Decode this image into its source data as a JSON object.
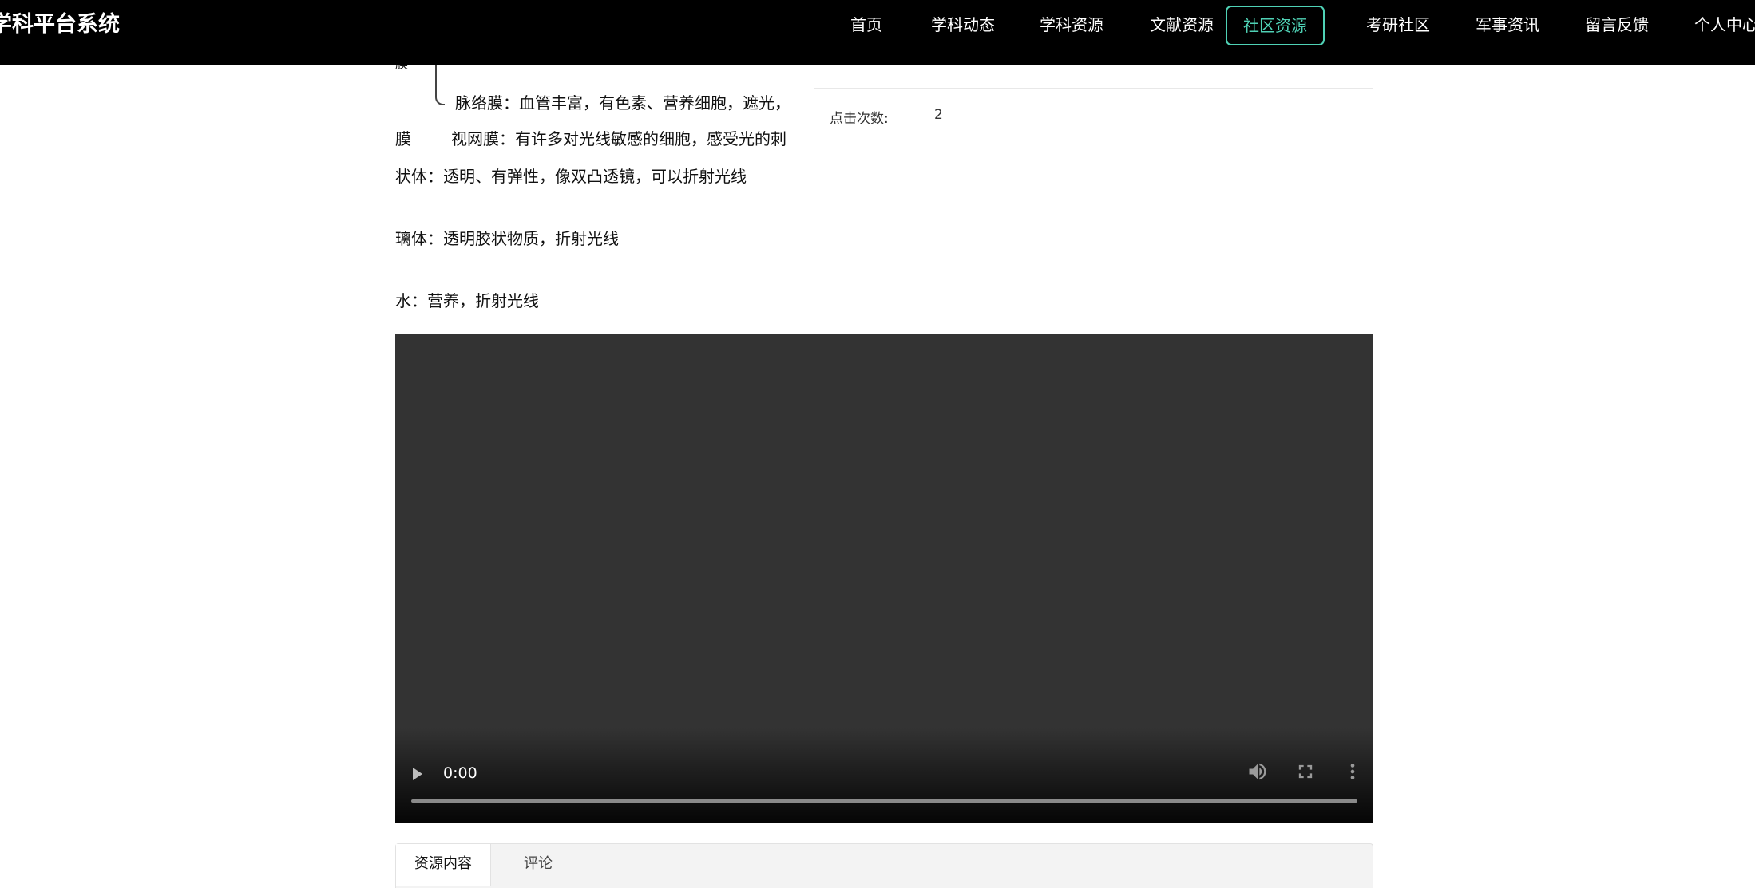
{
  "header": {
    "brand": "学科平台系统",
    "nav": [
      {
        "label": "首页",
        "active": false
      },
      {
        "label": "学科动态",
        "active": false
      },
      {
        "label": "学科资源",
        "active": false
      },
      {
        "label": "文献资源",
        "active": false
      },
      {
        "label": "社区资源",
        "active": true
      },
      {
        "label": "考研社区",
        "active": false
      },
      {
        "label": "军事资讯",
        "active": false
      },
      {
        "label": "留言反馈",
        "active": false
      },
      {
        "label": "个人中心",
        "active": false
      }
    ],
    "accent_color": "#4fd1b5"
  },
  "document_image": {
    "lines": [
      "膜",
      "脉络膜：血管丰富，有色素、营养细胞，遮光，",
      "膜",
      "视网膜：有许多对光线敏感的细胞，感受光的刺",
      "状体：透明、有弹性，像双凸透镜，可以折射光线",
      "璃体：透明胶状物质，折射光线",
      "水：营养，折射光线"
    ]
  },
  "info": {
    "clicks_label": "点击次数:",
    "clicks_value": "2"
  },
  "video": {
    "time": "0:00",
    "icons": [
      "play-icon",
      "volume-icon",
      "fullscreen-icon",
      "more-options-icon"
    ]
  },
  "tabs": [
    {
      "label": "资源内容",
      "active": true
    },
    {
      "label": "评论",
      "active": false
    }
  ]
}
